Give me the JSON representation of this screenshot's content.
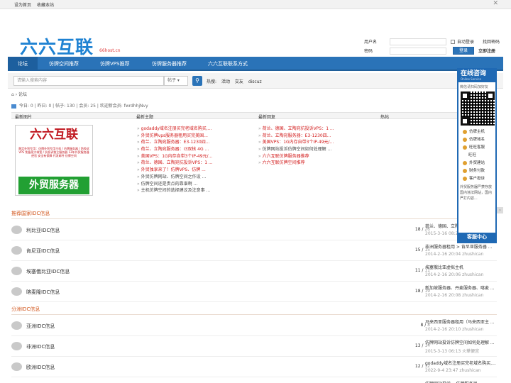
{
  "topbar": {
    "links": [
      "设为首页",
      "收藏本站"
    ],
    "close": "✕"
  },
  "logo": {
    "text": "六六互联",
    "sub": "66host.cn"
  },
  "login": {
    "username_label": "用户名",
    "password_label": "密码",
    "auto_login": "自动登录",
    "forgot": "找回密码",
    "submit": "登录",
    "register": "立即注册"
  },
  "nav": {
    "items": [
      "论坛",
      "仿牌空间推荐",
      "仿牌VPS推荐",
      "仿牌服务器推荐",
      "六六互联联系方式"
    ]
  },
  "search": {
    "placeholder": "请输入搜索内容",
    "scope": "帖子",
    "hot_label": "热搜:",
    "hot": [
      "活动",
      "交友",
      "discuz"
    ]
  },
  "breadcrumb": {
    "home_icon": "⌂",
    "current": "论坛"
  },
  "stats": {
    "today": "今日: 0",
    "yesterday": "昨日: 0",
    "posts": "帖子: 130",
    "members": "会员: 25",
    "welcome": "欢迎新会员: fwrdhhjNvy"
  },
  "grid": {
    "headers": [
      "最新图片",
      "最新主题",
      "最新回复",
      "热帖"
    ],
    "banner": {
      "title": "六六互联",
      "text": "稳定外贸专用：仿牌外贸专用主机 / 仿牌服务器 / 防投诉VPS 免备案大带宽 / 抗投诉独立服务器 13年外贸服务器经验 安全有保障 代发邮件 仿牌空间",
      "bottom": "外贸服务器"
    },
    "new_topics": [
      {
        "text": "godaddy域名注册买完老域名购买,...",
        "red": true
      },
      {
        "text": "外贸仿牌vps服务器租用买完美国...",
        "red": true
      },
      {
        "text": "荷兰、立陶宛服务器：E3-1230四...",
        "red": true
      },
      {
        "text": "荷兰、立陶宛服务器：I3双核 4G ...",
        "red": true
      },
      {
        "text": "美国VPS：1G内存自带3个IP-49元/...",
        "red": true
      },
      {
        "text": "荷兰、德国、立陶宛抗投诉VPS：1 ...",
        "red": true
      },
      {
        "text": "外贸独享来了！仿牌VPS、仿牌 ...",
        "red": true
      },
      {
        "text": "外贸仿牌网站、仿牌空间之作设 ...",
        "red": false
      },
      {
        "text": "仿牌空间还是贵点的靠谱啊 ...",
        "red": false
      },
      {
        "text": "主机仿牌空间的选择建议及注意事 ...",
        "red": false
      }
    ],
    "new_replies": [
      {
        "text": "荷兰、德国、立陶宛抗投诉VPS：1 ...",
        "red": true
      },
      {
        "text": "荷兰、立陶宛服务器：E3-1230四...",
        "red": true
      },
      {
        "text": "美国VPS：1G内存自带3个IP-49元/...",
        "red": true
      },
      {
        "text": "仿牌网站投诉仿牌空间如何处理解 ...",
        "red": false
      },
      {
        "text": "六六互联仿牌服务器推荐",
        "red": true
      },
      {
        "text": "六六互联仿牌空间推荐",
        "red": true
      }
    ]
  },
  "sections": [
    {
      "title": "推荐国家IDC信息",
      "forums": [
        {
          "name": "利比亚IDC信息",
          "threads": "18",
          "posts": "26",
          "last_title": "荷兰、德国、立陶宛抗投诉VPS：1 ...",
          "last_meta": "2015-3-16 08:22"
        },
        {
          "name": "肯尼亚IDC信息",
          "threads": "15",
          "posts": "15",
          "last_title": "非洲服务器租用 > 肯尼亚服务器 ...",
          "last_meta": "2014-2-16 20:04 zhushican"
        },
        {
          "name": "埃塞俄比亚IDC信息",
          "threads": "11",
          "posts": "11",
          "last_title": "埃塞俄比亚虚拟主机",
          "last_meta": "2014-2-16 20:06 zhushican"
        },
        {
          "name": "喀麦隆IDC信息",
          "threads": "18",
          "posts": "19",
          "last_title": "新加坡服务器、丹麦服务器、喀麦 ...",
          "last_meta": "2014-2-16 20:08 zhushican"
        }
      ]
    },
    {
      "title": "分洲IDC信息",
      "forums": [
        {
          "name": "亚洲IDC信息",
          "threads": "8",
          "posts": "8",
          "last_title": "马来西亚服务器租用（马来西亚主 ...",
          "last_meta": "2014-2-16 20:10 zhushican"
        },
        {
          "name": "非洲IDC信息",
          "threads": "13",
          "posts": "14",
          "last_title": "仿牌网站投诉仿牌空间如何处理解 ...",
          "last_meta": "2015-3-13 06:13 火華便宜"
        },
        {
          "name": "欧洲IDC信息",
          "threads": "12",
          "posts": "12",
          "last_title": "godaddy域名注册买完老域名购买,...",
          "last_meta": "2022-9-4 23:47 zhushican"
        },
        {
          "name": "",
          "threads": "",
          "posts": "",
          "last_title": "仿牌网站投诉... 仿牌服务器 ...",
          "last_meta": ""
        }
      ]
    }
  ],
  "float_panel": {
    "title": "在线咨询",
    "subtitle": "Online Service",
    "tip": "微信请扫码加好友",
    "services": [
      "仿牌主机",
      "仿牌域名",
      "旺旺客服",
      "外贸建站",
      "财务付款",
      "客户投诉"
    ],
    "wangwang": "旺旺",
    "note": "外贸服务器严禁存放国内违法网站，国内严打内容...",
    "footer": "客服中心"
  },
  "colors": {
    "brand_blue": "#2a73b8",
    "accent_red": "#d21b1b",
    "section_orange": "#d2551b"
  }
}
